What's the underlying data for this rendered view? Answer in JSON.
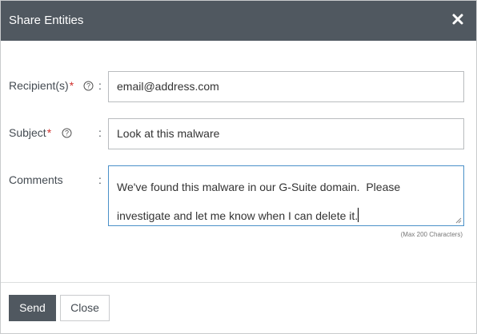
{
  "dialog": {
    "title": "Share Entities",
    "close_icon": "close-icon"
  },
  "form": {
    "recipients": {
      "label": "Recipient(s)",
      "required_mark": "*",
      "help_icon": "help-circle-icon",
      "separator": ":",
      "value": "email@address.com"
    },
    "subject": {
      "label": "Subject",
      "required_mark": "*",
      "help_icon": "help-circle-icon",
      "separator": ":",
      "value": "Look at this malware"
    },
    "comments": {
      "label": "Comments",
      "separator": ":",
      "value": "We've found this malware in our G-Suite domain.  Please\ninvestigate and let me know when I can delete it.",
      "max_note": "(Max 200 Characters)"
    }
  },
  "footer": {
    "send_label": "Send",
    "close_label": "Close"
  },
  "colors": {
    "header_bg": "#505860",
    "required": "#d0312d",
    "focus_border": "#4a90c8",
    "primary_button": "#505860"
  }
}
